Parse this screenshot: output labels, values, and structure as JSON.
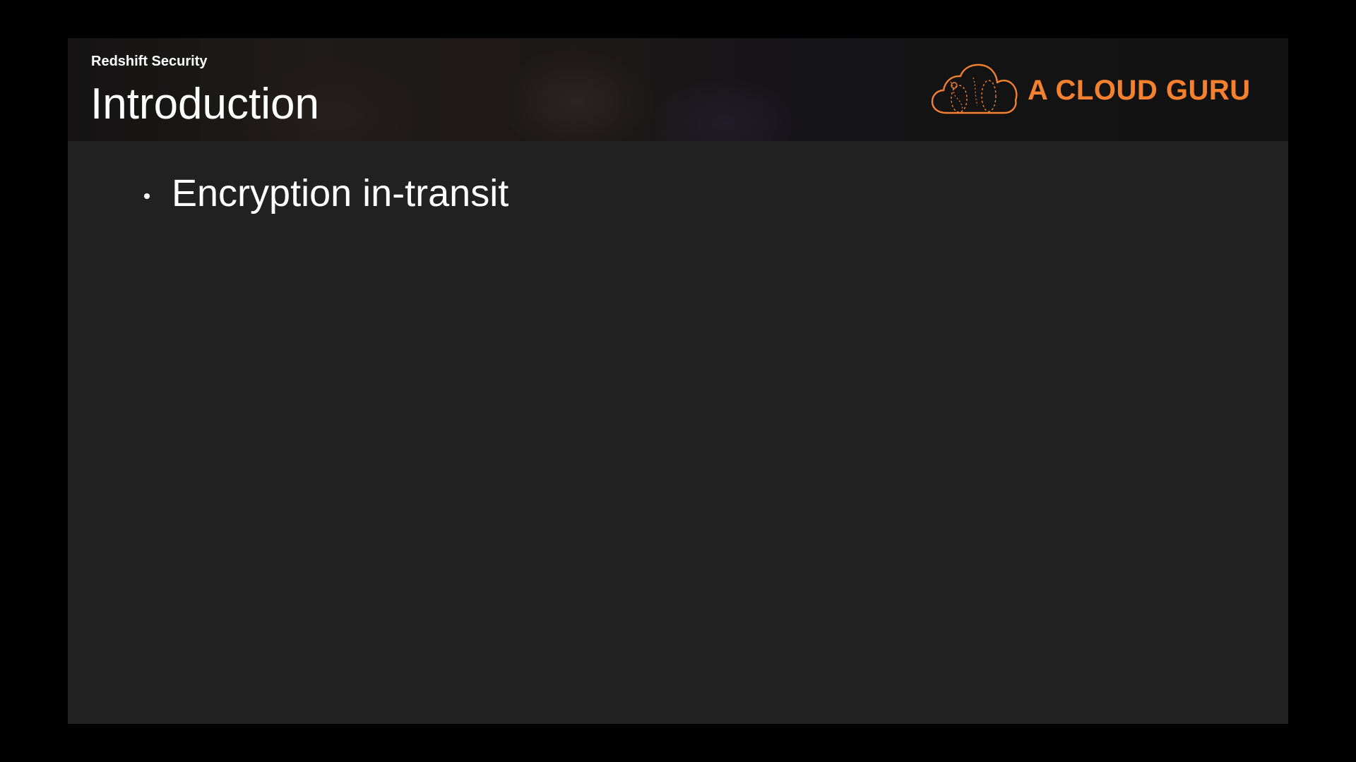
{
  "header": {
    "section_label": "Redshift Security",
    "title": "Introduction"
  },
  "logo": {
    "text": "A CLOUD GURU",
    "icon": "cloud-logo-icon",
    "color": "#f5812f"
  },
  "content": {
    "bullets": [
      {
        "text": "Encryption in-transit"
      }
    ]
  },
  "colors": {
    "background": "#000000",
    "slide_background": "#212121",
    "text": "#ffffff",
    "accent": "#f5812f"
  }
}
